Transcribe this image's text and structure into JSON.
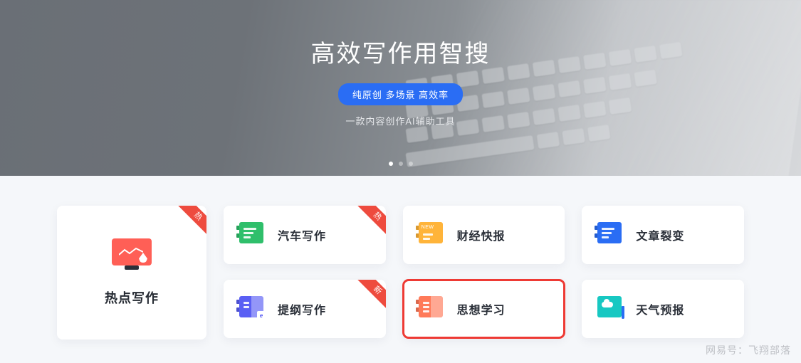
{
  "hero": {
    "title": "高效写作用智搜",
    "pill": "纯原创 多场景 高效率",
    "subtitle": "一款内容创作AI辅助工具",
    "active_dot": 0,
    "dot_count": 3
  },
  "ribbons": {
    "hot": "热",
    "new": "新"
  },
  "big_card": {
    "label": "热点写作",
    "ribbon": "hot",
    "icon": "hotspot"
  },
  "cards": [
    {
      "label": "汽车写作",
      "icon": "doc-green",
      "ribbon": "hot"
    },
    {
      "label": "财经快报",
      "icon": "doc-orange-new",
      "ribbon": null
    },
    {
      "label": "文章裂变",
      "icon": "doc-blue",
      "ribbon": null
    },
    {
      "label": "提纲写作",
      "icon": "doc-purple-e",
      "ribbon": "new"
    },
    {
      "label": "思想学习",
      "icon": "doc-coral-split",
      "ribbon": null,
      "selected": true
    },
    {
      "label": "天气预报",
      "icon": "weather-teal",
      "ribbon": null
    }
  ],
  "watermark": "网易号：飞翔部落"
}
